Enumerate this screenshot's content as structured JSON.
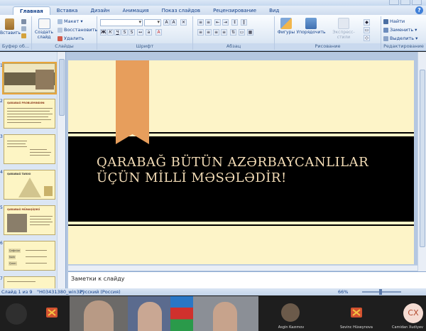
{
  "ribbon": {
    "tabs": [
      "Главная",
      "Вставка",
      "Дизайн",
      "Анимация",
      "Показ слайдов",
      "Рецензирование",
      "Вид"
    ],
    "clipboard": {
      "paste_label": "Вставить",
      "group_label": "Буфер об..."
    },
    "slides": {
      "create_label": "Создать слайд",
      "layout_label": "Макет",
      "restore_label": "Восстановить",
      "delete_label": "Удалить",
      "group_label": "Слайды"
    },
    "font": {
      "group_label": "Шрифт"
    },
    "paragraph": {
      "group_label": "Абзац"
    },
    "drawing": {
      "shapes_label": "Фигуры",
      "arrange_label": "Упорядочить",
      "quick_styles_label": "Экспресс-стили",
      "group_label": "Рисование"
    },
    "editing": {
      "find_label": "Найти",
      "replace_label": "Заменить",
      "select_label": "Выделить",
      "group_label": "Редактирование"
    }
  },
  "slide_panel": {
    "numbers": [
      "1",
      "2",
      "3",
      "4",
      "5",
      "6",
      "7"
    ],
    "thumb2_title": "QARABAĞ PROBLEMINDƏN",
    "thumb4_title": "QARABAĞ TARIXI",
    "thumb5_title": "QARABAĞ MÜNAQİŞƏSİ",
    "thumb6_cells": [
      "Qırğınlar",
      "Nəhr",
      "Qırım"
    ]
  },
  "slide": {
    "title_line1": "QARABAĞ BÜTÜN AZƏRBAYCANLILAR",
    "title_line2": "ÜÇÜN MİLLİ MƏSƏLƏDİR!"
  },
  "notes": {
    "placeholder": "Заметки к слайду"
  },
  "status": {
    "slide_counter": "Слайд 1 из 9",
    "theme": "\"Н03431380_win32\"",
    "language": "Русский (Россия)",
    "zoom": "66%"
  },
  "video": {
    "participants": [
      "Asgin Kazımov",
      "Sevinc Hüseynova",
      "Camidan Xudiyev"
    ],
    "avatar_initials": "CX"
  },
  "colors": {
    "slide_bg": "#fdf4c8",
    "band": "#000000",
    "bookmark": "#e79e5c",
    "title_text": "#f3dcb6"
  }
}
